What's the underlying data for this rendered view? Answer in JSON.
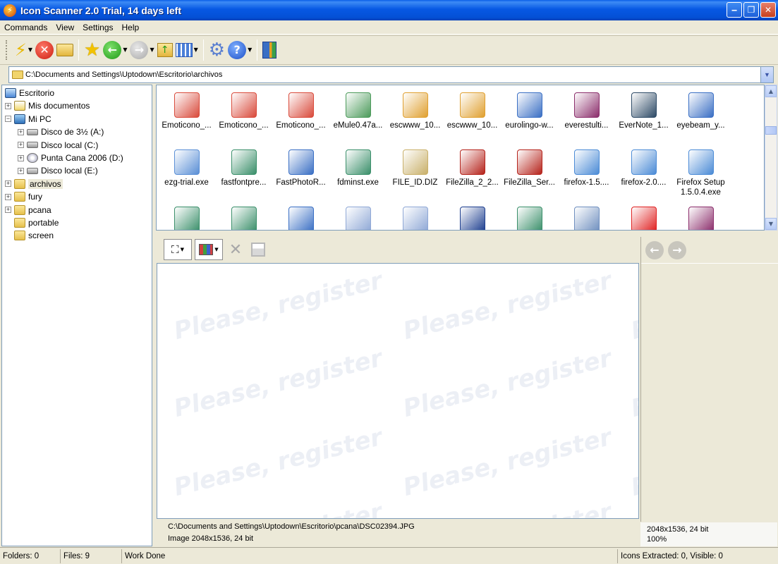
{
  "window": {
    "title": "Icon Scanner 2.0 Trial, 14 days left"
  },
  "menu": [
    "Commands",
    "View",
    "Settings",
    "Help"
  ],
  "address": {
    "path": "C:\\Documents and Settings\\Uptodown\\Escritorio\\archivos"
  },
  "tree": [
    {
      "label": "Escritorio",
      "icon": "desktop-icon",
      "depth": 0,
      "expander": ""
    },
    {
      "label": "Mis documentos",
      "icon": "documents-icon",
      "depth": 1,
      "expander": "+"
    },
    {
      "label": "Mi PC",
      "icon": "computer-icon",
      "depth": 1,
      "expander": "−"
    },
    {
      "label": "Disco de 3½ (A:)",
      "icon": "floppy-icon",
      "depth": 2,
      "expander": "+"
    },
    {
      "label": "Disco local (C:)",
      "icon": "drive-icon",
      "depth": 2,
      "expander": "+"
    },
    {
      "label": "Punta Cana 2006 (D:)",
      "icon": "cd-icon",
      "depth": 2,
      "expander": "+"
    },
    {
      "label": "Disco local (E:)",
      "icon": "drive-icon",
      "depth": 2,
      "expander": "+"
    },
    {
      "label": "archivos",
      "icon": "folder-icon",
      "depth": 1,
      "expander": "+",
      "selected": true
    },
    {
      "label": "fury",
      "icon": "folder-icon",
      "depth": 1,
      "expander": "+"
    },
    {
      "label": "pcana",
      "icon": "folder-icon",
      "depth": 1,
      "expander": "+"
    },
    {
      "label": "portable",
      "icon": "folder-icon",
      "depth": 1,
      "expander": ""
    },
    {
      "label": "screen",
      "icon": "folder-icon",
      "depth": 1,
      "expander": ""
    }
  ],
  "files": [
    {
      "name": "Emoticono_...",
      "icon": "emoticon-file-icon",
      "color": "#d94a3b"
    },
    {
      "name": "Emoticono_...",
      "icon": "emoticon-file-icon",
      "color": "#d94a3b"
    },
    {
      "name": "Emoticono_...",
      "icon": "emoticon-file-icon",
      "color": "#d94a3b"
    },
    {
      "name": "eMule0.47a...",
      "icon": "emule-icon",
      "color": "#4b9a5a"
    },
    {
      "name": "escwww_10...",
      "icon": "script-file-icon",
      "color": "#e0a030"
    },
    {
      "name": "escwww_10...",
      "icon": "script-file-icon",
      "color": "#e0a030"
    },
    {
      "name": "eurolingo-w...",
      "icon": "installer-icon",
      "color": "#3a6fc4"
    },
    {
      "name": "everestulti...",
      "icon": "archive-icon",
      "color": "#8b2d6b"
    },
    {
      "name": "EverNote_1...",
      "icon": "evernote-icon",
      "color": "#2d4a66"
    },
    {
      "name": "eyebeam_y...",
      "icon": "installer-icon",
      "color": "#3a6fc4"
    },
    {
      "name": "ezg-trial.exe",
      "icon": "setup-icon",
      "color": "#5a8fd6"
    },
    {
      "name": "fastfontpre...",
      "icon": "setup-cd-icon",
      "color": "#3a8f6a"
    },
    {
      "name": "FastPhotoR...",
      "icon": "installer-icon",
      "color": "#3a6fc4"
    },
    {
      "name": "fdminst.exe",
      "icon": "setup-cd-icon",
      "color": "#3a8f6a"
    },
    {
      "name": "FILE_ID.DIZ",
      "icon": "text-file-icon",
      "color": "#c9b06a"
    },
    {
      "name": "FileZilla_2_2...",
      "icon": "filezilla-icon",
      "color": "#b5231b"
    },
    {
      "name": "FileZilla_Ser...",
      "icon": "filezilla-icon",
      "color": "#b5231b"
    },
    {
      "name": "firefox-1.5....",
      "icon": "firefox-setup-icon",
      "color": "#4b8bd6"
    },
    {
      "name": "firefox-2.0....",
      "icon": "firefox-setup-icon",
      "color": "#4b8bd6"
    },
    {
      "name": "Firefox Setup 1.5.0.4.exe",
      "icon": "firefox-setup-icon",
      "color": "#4b8bd6"
    },
    {
      "name": "",
      "icon": "setup-cd-icon",
      "color": "#3a8f6a"
    },
    {
      "name": "",
      "icon": "setup-cd-icon",
      "color": "#3a8f6a"
    },
    {
      "name": "",
      "icon": "installer-icon",
      "color": "#3a6fc4"
    },
    {
      "name": "",
      "icon": "disc-icon",
      "color": "#8fa8d6"
    },
    {
      "name": "",
      "icon": "disc-icon",
      "color": "#8fa8d6"
    },
    {
      "name": "",
      "icon": "arrow-logo-icon",
      "color": "#1d3e8f"
    },
    {
      "name": "",
      "icon": "setup-cd-icon",
      "color": "#3a8f6a"
    },
    {
      "name": "",
      "icon": "window-icon",
      "color": "#6f8fbf"
    },
    {
      "name": "",
      "icon": "red-arrow-icon",
      "color": "#e02020"
    },
    {
      "name": "",
      "icon": "archive-icon",
      "color": "#8b2d6b"
    }
  ],
  "preview": {
    "watermark": "Please, register",
    "path": "C:\\Documents and Settings\\Uptodown\\Escritorio\\pcana\\DSC02394.JPG",
    "image_info": "Image 2048x1536, 24 bit"
  },
  "right_info": {
    "line1": "2048x1536, 24 bit",
    "line2": "100%"
  },
  "status": {
    "folders": "Folders: 0",
    "files": "Files: 9",
    "state": "Work Done",
    "icons": "Icons Extracted: 0, Visible: 0"
  }
}
